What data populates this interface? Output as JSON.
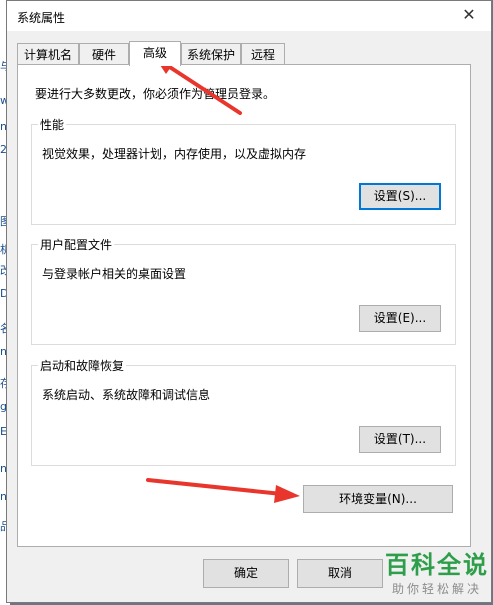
{
  "window": {
    "title": "系统属性",
    "close_glyph": "✕"
  },
  "tabs": [
    {
      "label": "计算机名"
    },
    {
      "label": "硬件"
    },
    {
      "label": "高级",
      "active": true
    },
    {
      "label": "系统保护"
    },
    {
      "label": "远程"
    }
  ],
  "notice": "要进行大多数更改，你必须作为管理员登录。",
  "groups": {
    "performance": {
      "title": "性能",
      "desc": "视觉效果，处理器计划，内存使用，以及虚拟内存",
      "button": "设置(S)..."
    },
    "profile": {
      "title": "用户配置文件",
      "desc": "与登录帐户相关的桌面设置",
      "button": "设置(E)..."
    },
    "startup": {
      "title": "启动和故障恢复",
      "desc": "系统启动、系统故障和调试信息",
      "button": "设置(T)..."
    }
  },
  "env_button": "环境变量(N)...",
  "footer": {
    "ok": "确定",
    "cancel": "取消"
  },
  "watermark": {
    "big": "百科全说",
    "small": "助你轻松解决"
  },
  "left_fragments": [
    "与",
    "w",
    "no",
    "20",
    "图",
    "机",
    "改",
    "D",
    "名",
    "n",
    "存",
    "g",
    "E",
    "no",
    "no",
    "品"
  ],
  "colors": {
    "arrow": "#e8362d",
    "accent": "#0078d7",
    "watermark": "#2e9e4a"
  }
}
